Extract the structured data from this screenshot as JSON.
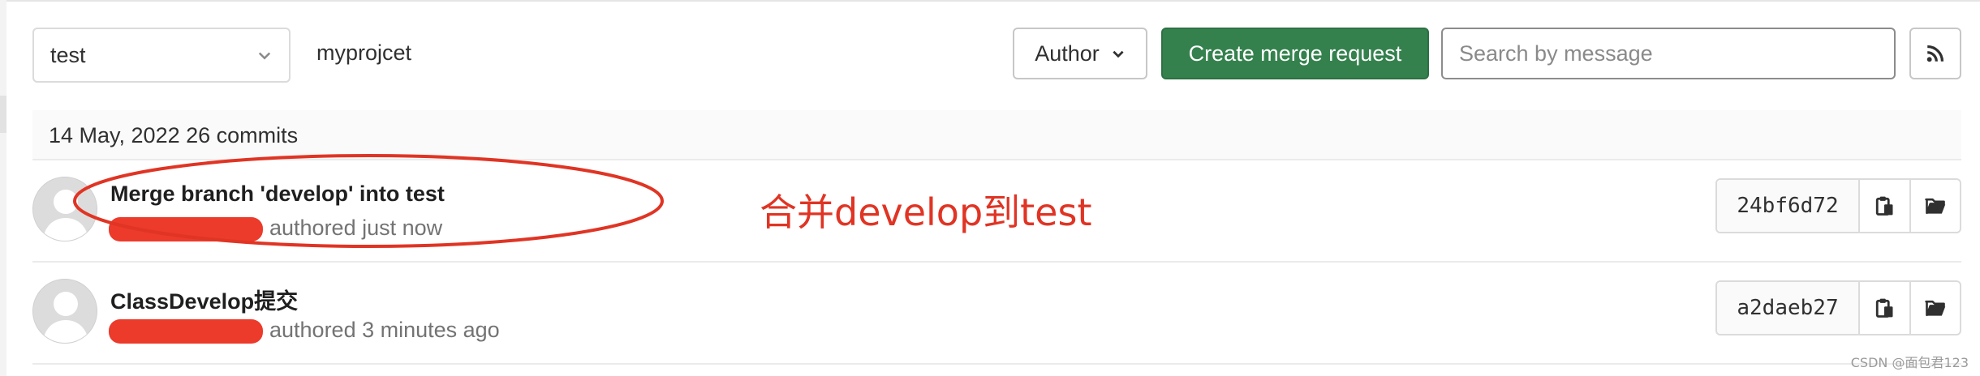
{
  "toolbar": {
    "branch": "test",
    "project": "myprojcet",
    "author_label": "Author",
    "create_mr_label": "Create merge request",
    "search_placeholder": "Search by message",
    "rss_icon": "rss-icon"
  },
  "day_group": {
    "header": "14 May, 2022 26 commits"
  },
  "commits": [
    {
      "title": "Merge branch 'develop' into test",
      "meta": "authored just now",
      "sha": "24bf6d72"
    },
    {
      "title": "ClassDevelop提交",
      "meta": "authored 3 minutes ago",
      "sha": "a2daeb27"
    }
  ],
  "annotation": {
    "text": "合并develop到test",
    "color": "#e03424"
  },
  "watermark": "CSDN @面包君123",
  "colors": {
    "primary_button": "#34814d",
    "redaction": "#ec3a2b"
  }
}
